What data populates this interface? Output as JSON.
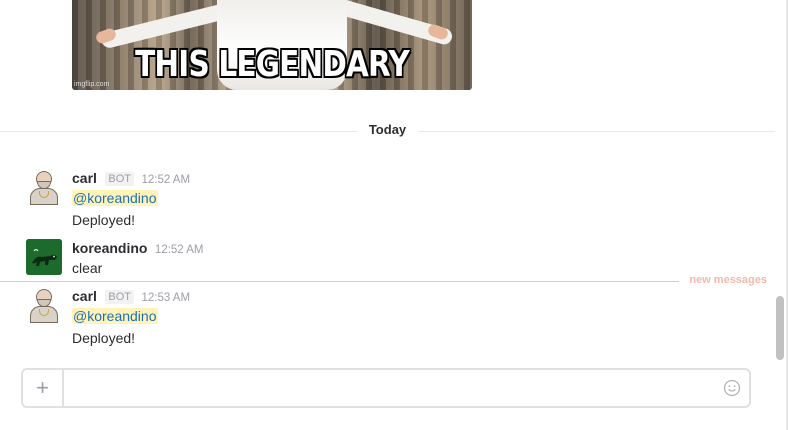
{
  "meme": {
    "caption": "THIS LEGENDARY",
    "watermark": "imgflip.com"
  },
  "day_divider": {
    "label": "Today"
  },
  "messages": [
    {
      "sender": "carl",
      "badge": "BOT",
      "time": "12:52 AM",
      "mention": "@koreandino",
      "text": "Deployed!",
      "avatar": "carl-avatar"
    },
    {
      "sender": "koreandino",
      "time": "12:52 AM",
      "text": "clear",
      "avatar": "dino-avatar"
    },
    {
      "sender": "carl",
      "badge": "BOT",
      "time": "12:53 AM",
      "mention": "@koreandino",
      "text": "Deployed!",
      "avatar": "carl-avatar"
    }
  ],
  "new_messages_divider": {
    "label": "new messages"
  },
  "composer": {
    "plus_label": "+",
    "placeholder": "",
    "emoji_icon": "smiley-icon",
    "plus_icon": "plus-icon"
  },
  "colors": {
    "mention_bg": "#fff3b8",
    "mention_text": "#1d70b8",
    "new_messages": "#f2b9ab"
  }
}
